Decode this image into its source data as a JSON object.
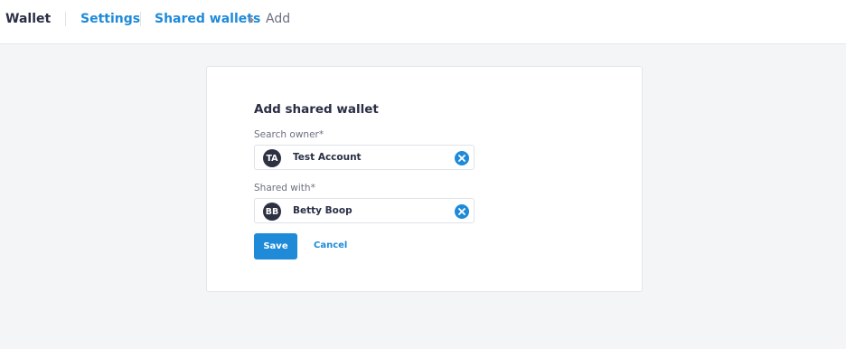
{
  "header": {
    "app_title": "Wallet",
    "breadcrumb": {
      "settings": "Settings",
      "shared_wallets": "Shared wallets",
      "current": "Add"
    }
  },
  "form": {
    "title": "Add shared wallet",
    "owner": {
      "label": "Search owner*",
      "avatar_initials": "TA",
      "value": "Test Account"
    },
    "shared_with": {
      "label": "Shared with*",
      "avatar_initials": "BB",
      "value": "Betty Boop"
    },
    "save_label": "Save",
    "cancel_label": "Cancel"
  },
  "icons": {
    "breadcrumb_separator": "chevron-right-icon",
    "clear": "close-circle-icon"
  },
  "colors": {
    "accent": "#1f8ad8",
    "avatar_bg": "#2d3142",
    "page_bg": "#f4f5f7"
  }
}
